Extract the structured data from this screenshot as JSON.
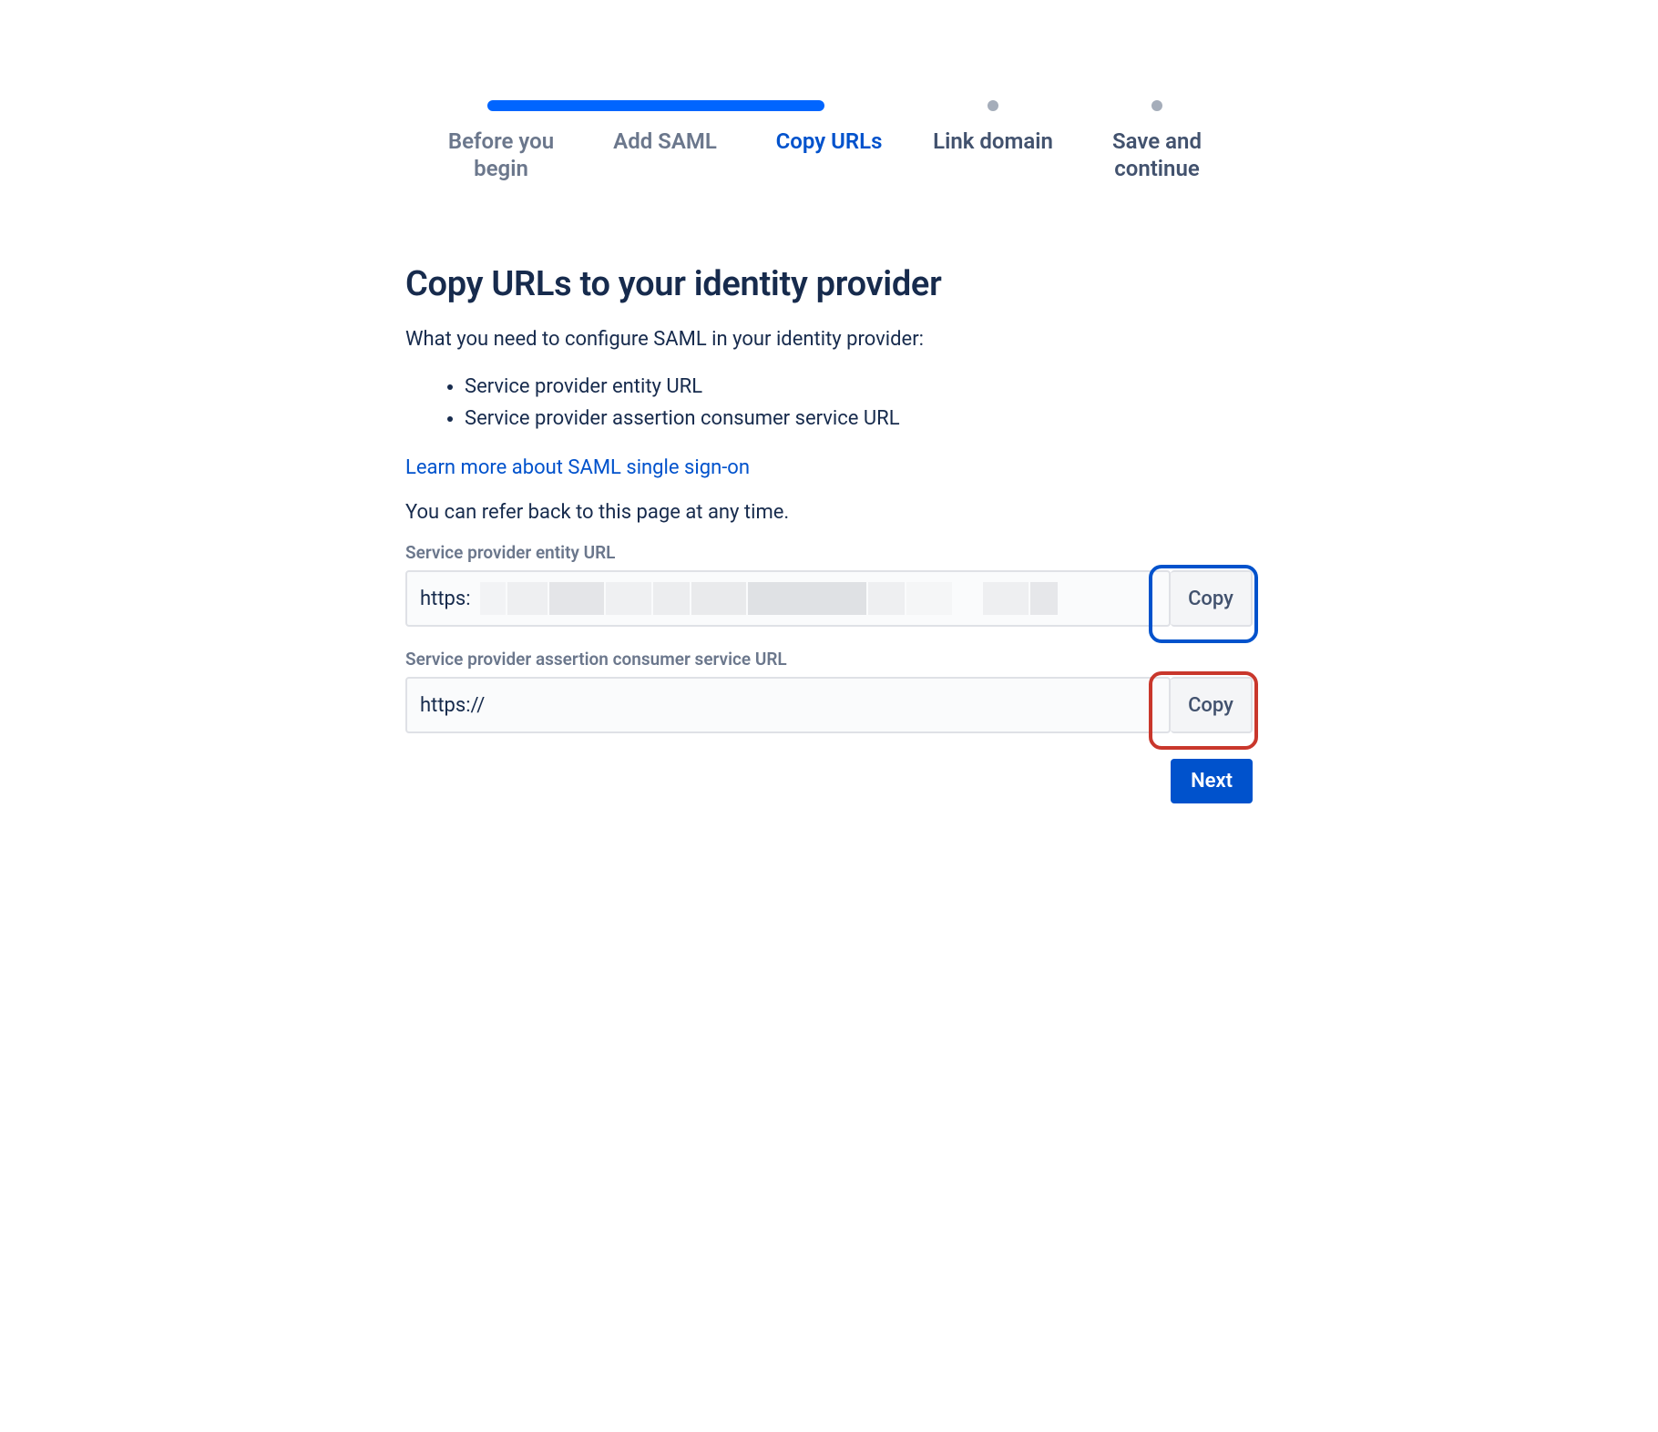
{
  "stepper": {
    "steps": [
      {
        "label": "Before you begin",
        "state": "completed"
      },
      {
        "label": "Add SAML",
        "state": "completed"
      },
      {
        "label": "Copy URLs",
        "state": "active"
      },
      {
        "label": "Link domain",
        "state": "upcoming"
      },
      {
        "label": "Save and continue",
        "state": "upcoming"
      }
    ]
  },
  "page": {
    "title": "Copy URLs to your identity provider",
    "intro": "What you need to configure SAML in your identity provider:",
    "bullets": [
      "Service provider entity URL",
      "Service provider assertion consumer service URL"
    ],
    "learn_more": "Learn more about SAML single sign-on",
    "refer_back": "You can refer back to this page at any time."
  },
  "fields": {
    "entity_url": {
      "label": "Service provider entity URL",
      "value_prefix": "https:",
      "copy_label": "Copy"
    },
    "acs_url": {
      "label": "Service provider assertion consumer service URL",
      "value": "https://",
      "copy_label": "Copy"
    }
  },
  "buttons": {
    "next": "Next"
  }
}
